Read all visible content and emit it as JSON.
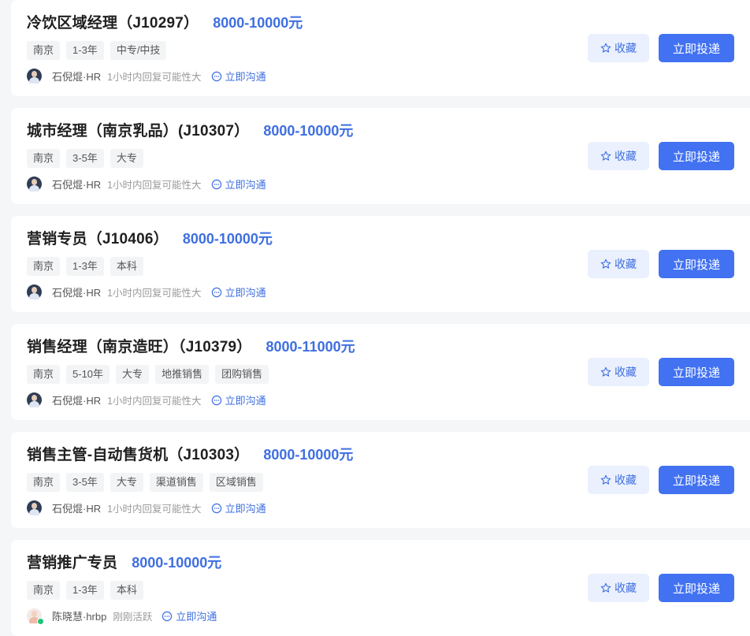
{
  "jobs": [
    {
      "title": "冷饮区域经理（J10297）",
      "salary": "8000-10000元",
      "tags": [
        "南京",
        "1-3年",
        "中专/中技"
      ],
      "hr_name": "石倪焜·HR",
      "hr_status": "1小时内回复可能性大",
      "chat": "立即沟通",
      "fav": "收藏",
      "apply": "立即投递",
      "avatar": "male-hr-avatar"
    },
    {
      "title": "城市经理（南京乳品）(J10307）",
      "salary": "8000-10000元",
      "tags": [
        "南京",
        "3-5年",
        "大专"
      ],
      "hr_name": "石倪焜·HR",
      "hr_status": "1小时内回复可能性大",
      "chat": "立即沟通",
      "fav": "收藏",
      "apply": "立即投递",
      "avatar": "male-hr-avatar"
    },
    {
      "title": "营销专员（J10406）",
      "salary": "8000-10000元",
      "tags": [
        "南京",
        "1-3年",
        "本科"
      ],
      "hr_name": "石倪焜·HR",
      "hr_status": "1小时内回复可能性大",
      "chat": "立即沟通",
      "fav": "收藏",
      "apply": "立即投递",
      "avatar": "male-hr-avatar"
    },
    {
      "title": "销售经理（南京造旺）（J10379）",
      "salary": "8000-11000元",
      "tags": [
        "南京",
        "5-10年",
        "大专",
        "地推销售",
        "团购销售"
      ],
      "hr_name": "石倪焜·HR",
      "hr_status": "1小时内回复可能性大",
      "chat": "立即沟通",
      "fav": "收藏",
      "apply": "立即投递",
      "avatar": "male-hr-avatar"
    },
    {
      "title": "销售主管-自动售货机（J10303）",
      "salary": "8000-10000元",
      "tags": [
        "南京",
        "3-5年",
        "大专",
        "渠道销售",
        "区域销售"
      ],
      "hr_name": "石倪焜·HR",
      "hr_status": "1小时内回复可能性大",
      "chat": "立即沟通",
      "fav": "收藏",
      "apply": "立即投递",
      "avatar": "male-hr-avatar"
    },
    {
      "title": "营销推广专员",
      "salary": "8000-10000元",
      "tags": [
        "南京",
        "1-3年",
        "本科"
      ],
      "hr_name": "陈晓慧·hrbp",
      "hr_status": "刚刚活跃",
      "chat": "立即沟通",
      "fav": "收藏",
      "apply": "立即投递",
      "avatar": "female-hr-avatar"
    }
  ],
  "colors": {
    "accent": "#4272f2",
    "salary": "#3f6fe0",
    "fav_bg": "#eaf0fd",
    "online": "#21c17a"
  }
}
